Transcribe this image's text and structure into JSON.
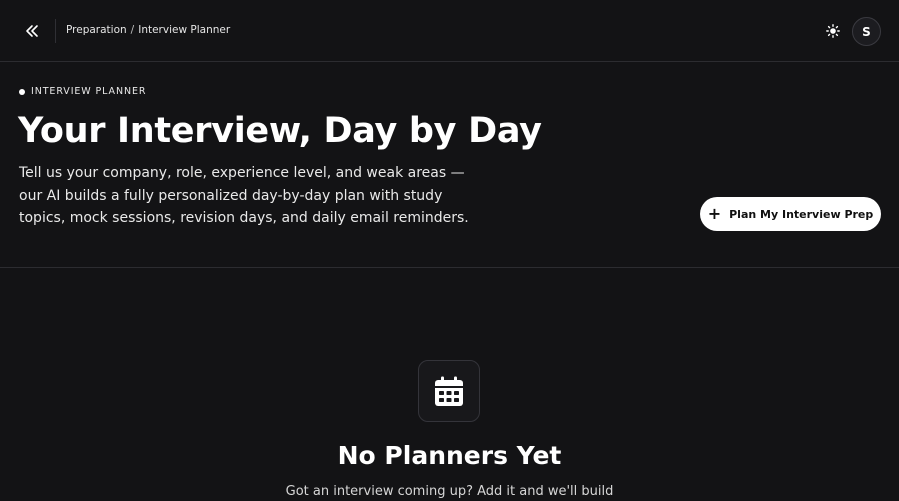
{
  "header": {
    "breadcrumb": {
      "parent": "Preparation",
      "separator": "/",
      "current": "Interview Planner"
    },
    "avatar_initial": "S",
    "icons": {
      "collapse": "double-chevron-left-icon",
      "theme": "sun-icon"
    }
  },
  "hero": {
    "eyebrow": "INTERVIEW PLANNER",
    "title": "Your Interview, Day by Day",
    "description": "Tell us your company, role, experience level, and weak areas — our AI builds a fully personalized day-by-day plan with study topics, mock sessions, revision days, and daily email reminders.",
    "cta_label": "Plan My Interview Prep",
    "cta_icon": "plus-icon"
  },
  "empty_state": {
    "icon": "calendar-icon",
    "title": "No Planners Yet",
    "description": "Got an interview coming up? Add it and we'll build"
  },
  "colors": {
    "background": "#131315",
    "border": "#2c2c30",
    "text": "#ffffff",
    "button_bg": "#ffffff",
    "button_text": "#111111"
  }
}
